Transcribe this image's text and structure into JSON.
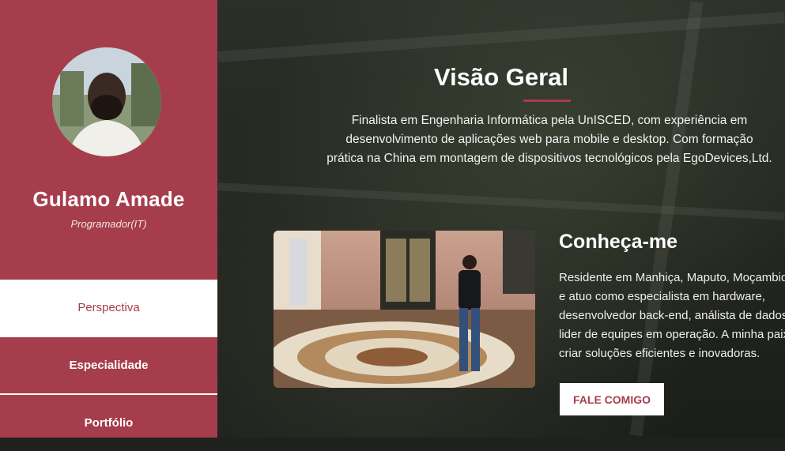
{
  "profile": {
    "name": "Gulamo Amade",
    "role": "Programador(IT)"
  },
  "nav": {
    "items": [
      {
        "label": "Perspectiva",
        "active": true
      },
      {
        "label": "Especialidade",
        "active": false
      },
      {
        "label": "Portfólio",
        "active": false
      }
    ]
  },
  "overview": {
    "title": "Visão Geral",
    "lines": [
      "Finalista em Engenharia Informática pela UnISCED, com experiência em",
      "desenvolvimento de aplicações web para mobile e desktop. Com formação",
      "prática na China em montagem de dispositivos tecnológicos pela EgoDevices,Ltd."
    ]
  },
  "about": {
    "title": "Conheça-me",
    "lines": [
      "Residente em Manhiça, Maputo, Moçambique",
      "e atuo como especialista em hardware,",
      "desenvolvedor back-end, análista de dados e",
      "lider de equipes em operação. A minha paixão",
      "criar soluções eficientes e inovadoras."
    ],
    "button_label": "FALE COMIGO"
  },
  "colors": {
    "accent": "#a63d4c",
    "white": "#ffffff"
  }
}
